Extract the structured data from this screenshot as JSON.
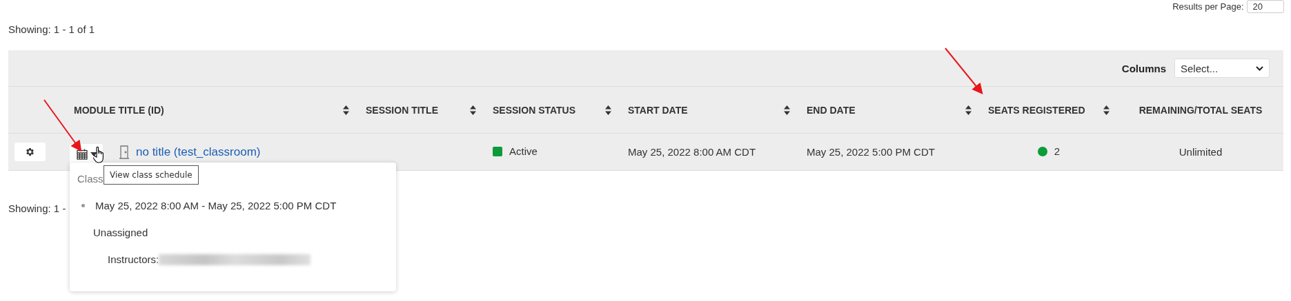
{
  "results_per_page": {
    "label": "Results per Page:",
    "value": "20"
  },
  "summary_top": "Showing: 1 - 1 of 1",
  "toolbar": {
    "columns_label": "Columns",
    "columns_select": "Select..."
  },
  "table": {
    "columns": [
      {
        "label": "MODULE TITLE (ID)",
        "sortable": true
      },
      {
        "label": "SESSION TITLE",
        "sortable": true
      },
      {
        "label": "SESSION STATUS",
        "sortable": true
      },
      {
        "label": "START DATE",
        "sortable": true
      },
      {
        "label": "END DATE",
        "sortable": true
      },
      {
        "label": "SEATS REGISTERED",
        "sortable": true
      },
      {
        "label": "REMAINING/TOTAL SEATS",
        "sortable": false
      }
    ],
    "rows": [
      {
        "title": "no title (test_classroom)",
        "session_title": "",
        "status": {
          "label": "Active",
          "color": "#0c9b3a"
        },
        "start": "May 25, 2022 8:00 AM CDT",
        "end": "May 25, 2022 5:00 PM CDT",
        "seats": {
          "count": "2",
          "color": "#0c9b3a"
        },
        "remaining": "Unlimited"
      }
    ]
  },
  "summary_bottom": "Showing: 1 -",
  "tooltip": "View class schedule",
  "schedule_popup": {
    "heading": "Class",
    "sessions": [
      {
        "time": "May 25, 2022 8:00 AM - May 25, 2022 5:00 PM CDT",
        "location": "Unassigned",
        "instructors_label": "Instructors:"
      }
    ]
  }
}
